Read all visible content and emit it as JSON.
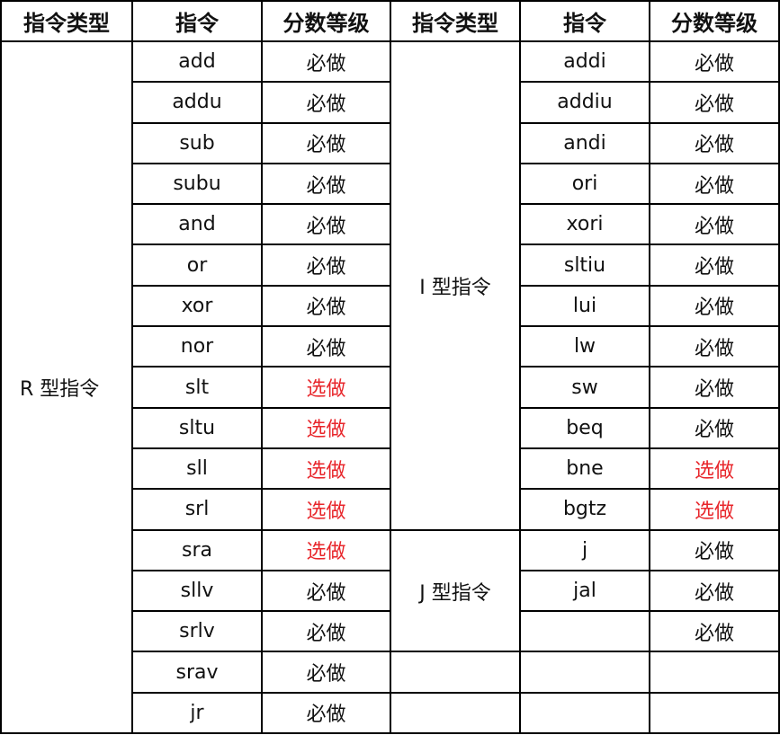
{
  "headers": [
    "指令类型",
    "指令",
    "分数等级",
    "指令类型",
    "指令",
    "分数等级"
  ],
  "left_group": {
    "type": "R 型指令",
    "rows": [
      {
        "instr": "add",
        "level": "必做",
        "optional": false
      },
      {
        "instr": "addu",
        "level": "必做",
        "optional": false
      },
      {
        "instr": "sub",
        "level": "必做",
        "optional": false
      },
      {
        "instr": "subu",
        "level": "必做",
        "optional": false
      },
      {
        "instr": "and",
        "level": "必做",
        "optional": false
      },
      {
        "instr": "or",
        "level": "必做",
        "optional": false
      },
      {
        "instr": "xor",
        "level": "必做",
        "optional": false
      },
      {
        "instr": "nor",
        "level": "必做",
        "optional": false
      },
      {
        "instr": "slt",
        "level": "选做",
        "optional": true
      },
      {
        "instr": "sltu",
        "level": "选做",
        "optional": true
      },
      {
        "instr": "sll",
        "level": "选做",
        "optional": true
      },
      {
        "instr": "srl",
        "level": "选做",
        "optional": true
      },
      {
        "instr": "sra",
        "level": "选做",
        "optional": true
      },
      {
        "instr": "sllv",
        "level": "必做",
        "optional": false
      },
      {
        "instr": "srlv",
        "level": "必做",
        "optional": false
      },
      {
        "instr": "srav",
        "level": "必做",
        "optional": false
      },
      {
        "instr": "jr",
        "level": "必做",
        "optional": false
      }
    ]
  },
  "right_groups": [
    {
      "type": "I 型指令",
      "rows": [
        {
          "instr": "addi",
          "level": "必做",
          "optional": false
        },
        {
          "instr": "addiu",
          "level": "必做",
          "optional": false
        },
        {
          "instr": "andi",
          "level": "必做",
          "optional": false
        },
        {
          "instr": "ori",
          "level": "必做",
          "optional": false
        },
        {
          "instr": "xori",
          "level": "必做",
          "optional": false
        },
        {
          "instr": "sltiu",
          "level": "必做",
          "optional": false
        },
        {
          "instr": "lui",
          "level": "必做",
          "optional": false
        },
        {
          "instr": "lw",
          "level": "必做",
          "optional": false
        },
        {
          "instr": "sw",
          "level": "必做",
          "optional": false
        },
        {
          "instr": "beq",
          "level": "必做",
          "optional": false
        },
        {
          "instr": "bne",
          "level": "选做",
          "optional": true
        },
        {
          "instr": "bgtz",
          "level": "选做",
          "optional": true
        }
      ]
    },
    {
      "type": "J 型指令",
      "rows": [
        {
          "instr": "j",
          "level": "必做",
          "optional": false
        },
        {
          "instr": "jal",
          "level": "必做",
          "optional": false
        },
        {
          "instr": "",
          "level": "必做",
          "optional": false
        }
      ]
    }
  ],
  "colors": {
    "required": "#111111",
    "optional": "#e8262b",
    "border": "#000000"
  }
}
